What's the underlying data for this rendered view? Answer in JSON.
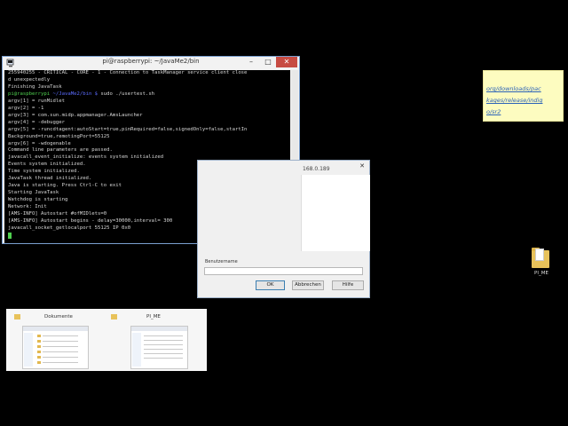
{
  "terminal": {
    "title": "pi@raspberrypi: ~/JavaMe2/bin",
    "controls": {
      "minimize": "–",
      "maximize": "□",
      "close": "✕"
    },
    "lines": [
      "255940255 - CRITICAL - CORE - 1 - Connection to TaskManager service client close",
      "d unexpectedly",
      "Finishing JavaTask",
      "argv[1] = runMidlet",
      "argv[2] = -1",
      "argv[3] = com.sun.midp.appmanager.AmsLauncher",
      "argv[4] = -debugger",
      "argv[5] = -runcdtagent:autoStart=true,pinRequired=false,signedOnly=false,startIn",
      "Background=true,remotingPort=55125",
      "argv[6] = -wdogenable",
      "Command line parameters are passed.",
      "javacall_event_initialize: events system initialized",
      "Events system initialized.",
      "Time system initialized.",
      "JavaTask thread initialized.",
      "Java is starting. Press Ctrl-C to exit",
      "Starting JavaTask",
      "Watchdog is starting",
      "Network: Init",
      "[AMS-INFO] Autostart #ofMIDlets=0",
      "[AMS-INFO] Autostart begins - delay=30000,interval= 300",
      "javacall_socket_getlocalport 55125 IP 0x0"
    ],
    "prompt": {
      "user": "pi@raspberrypi",
      "path": "~/JavaMe2/bin $",
      "command": " sudo ./usertest.sh"
    }
  },
  "dialog": {
    "title_fragment": "168.0.189",
    "close": "✕",
    "username_label": "Benutzername",
    "buttons": {
      "ok": "OK",
      "cancel": "Abbrechen",
      "help": "Hilfe"
    }
  },
  "note": {
    "link_lines": [
      "org/downloads/pac",
      "kages/release/indig",
      "o/sr2"
    ]
  },
  "desktop": {
    "folder_label": "PI_ME"
  },
  "taskbar_preview": {
    "items": [
      {
        "title": "Dokumente",
        "icon": "folder-icon"
      },
      {
        "title": "PI_ME",
        "icon": "folder-icon"
      }
    ]
  },
  "colors": {
    "desktop_bg": "#000000",
    "terminal_bg": "#000000",
    "terminal_text": "#d7d7d7",
    "prompt_user": "#4fd04f",
    "prompt_path": "#5b6cff",
    "close_button": "#c74b42",
    "note_bg": "#fdfcc0",
    "link": "#2b62b8"
  }
}
